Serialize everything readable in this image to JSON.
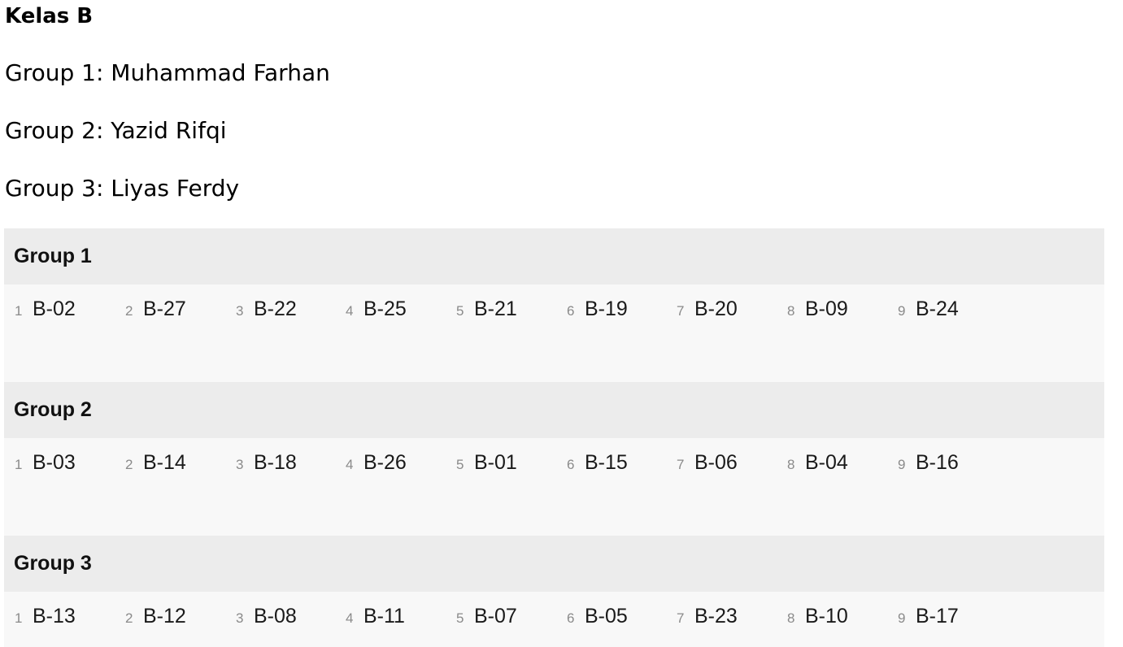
{
  "title": "Kelas B",
  "leaders": [
    "Group 1: Muhammad Farhan",
    "Group 2: Yazid Rifqi",
    "Group 3: Liyas Ferdy"
  ],
  "groups": [
    {
      "name": "Group 1",
      "members": [
        {
          "num": "1",
          "code": "B-02"
        },
        {
          "num": "2",
          "code": "B-27"
        },
        {
          "num": "3",
          "code": "B-22"
        },
        {
          "num": "4",
          "code": "B-25"
        },
        {
          "num": "5",
          "code": "B-21"
        },
        {
          "num": "6",
          "code": "B-19"
        },
        {
          "num": "7",
          "code": "B-20"
        },
        {
          "num": "8",
          "code": "B-09"
        },
        {
          "num": "9",
          "code": "B-24"
        }
      ]
    },
    {
      "name": "Group 2",
      "members": [
        {
          "num": "1",
          "code": "B-03"
        },
        {
          "num": "2",
          "code": "B-14"
        },
        {
          "num": "3",
          "code": "B-18"
        },
        {
          "num": "4",
          "code": "B-26"
        },
        {
          "num": "5",
          "code": "B-01"
        },
        {
          "num": "6",
          "code": "B-15"
        },
        {
          "num": "7",
          "code": "B-06"
        },
        {
          "num": "8",
          "code": "B-04"
        },
        {
          "num": "9",
          "code": "B-16"
        }
      ]
    },
    {
      "name": "Group 3",
      "members": [
        {
          "num": "1",
          "code": "B-13"
        },
        {
          "num": "2",
          "code": "B-12"
        },
        {
          "num": "3",
          "code": "B-08"
        },
        {
          "num": "4",
          "code": "B-11"
        },
        {
          "num": "5",
          "code": "B-07"
        },
        {
          "num": "6",
          "code": "B-05"
        },
        {
          "num": "7",
          "code": "B-23"
        },
        {
          "num": "8",
          "code": "B-10"
        },
        {
          "num": "9",
          "code": "B-17"
        }
      ]
    }
  ]
}
